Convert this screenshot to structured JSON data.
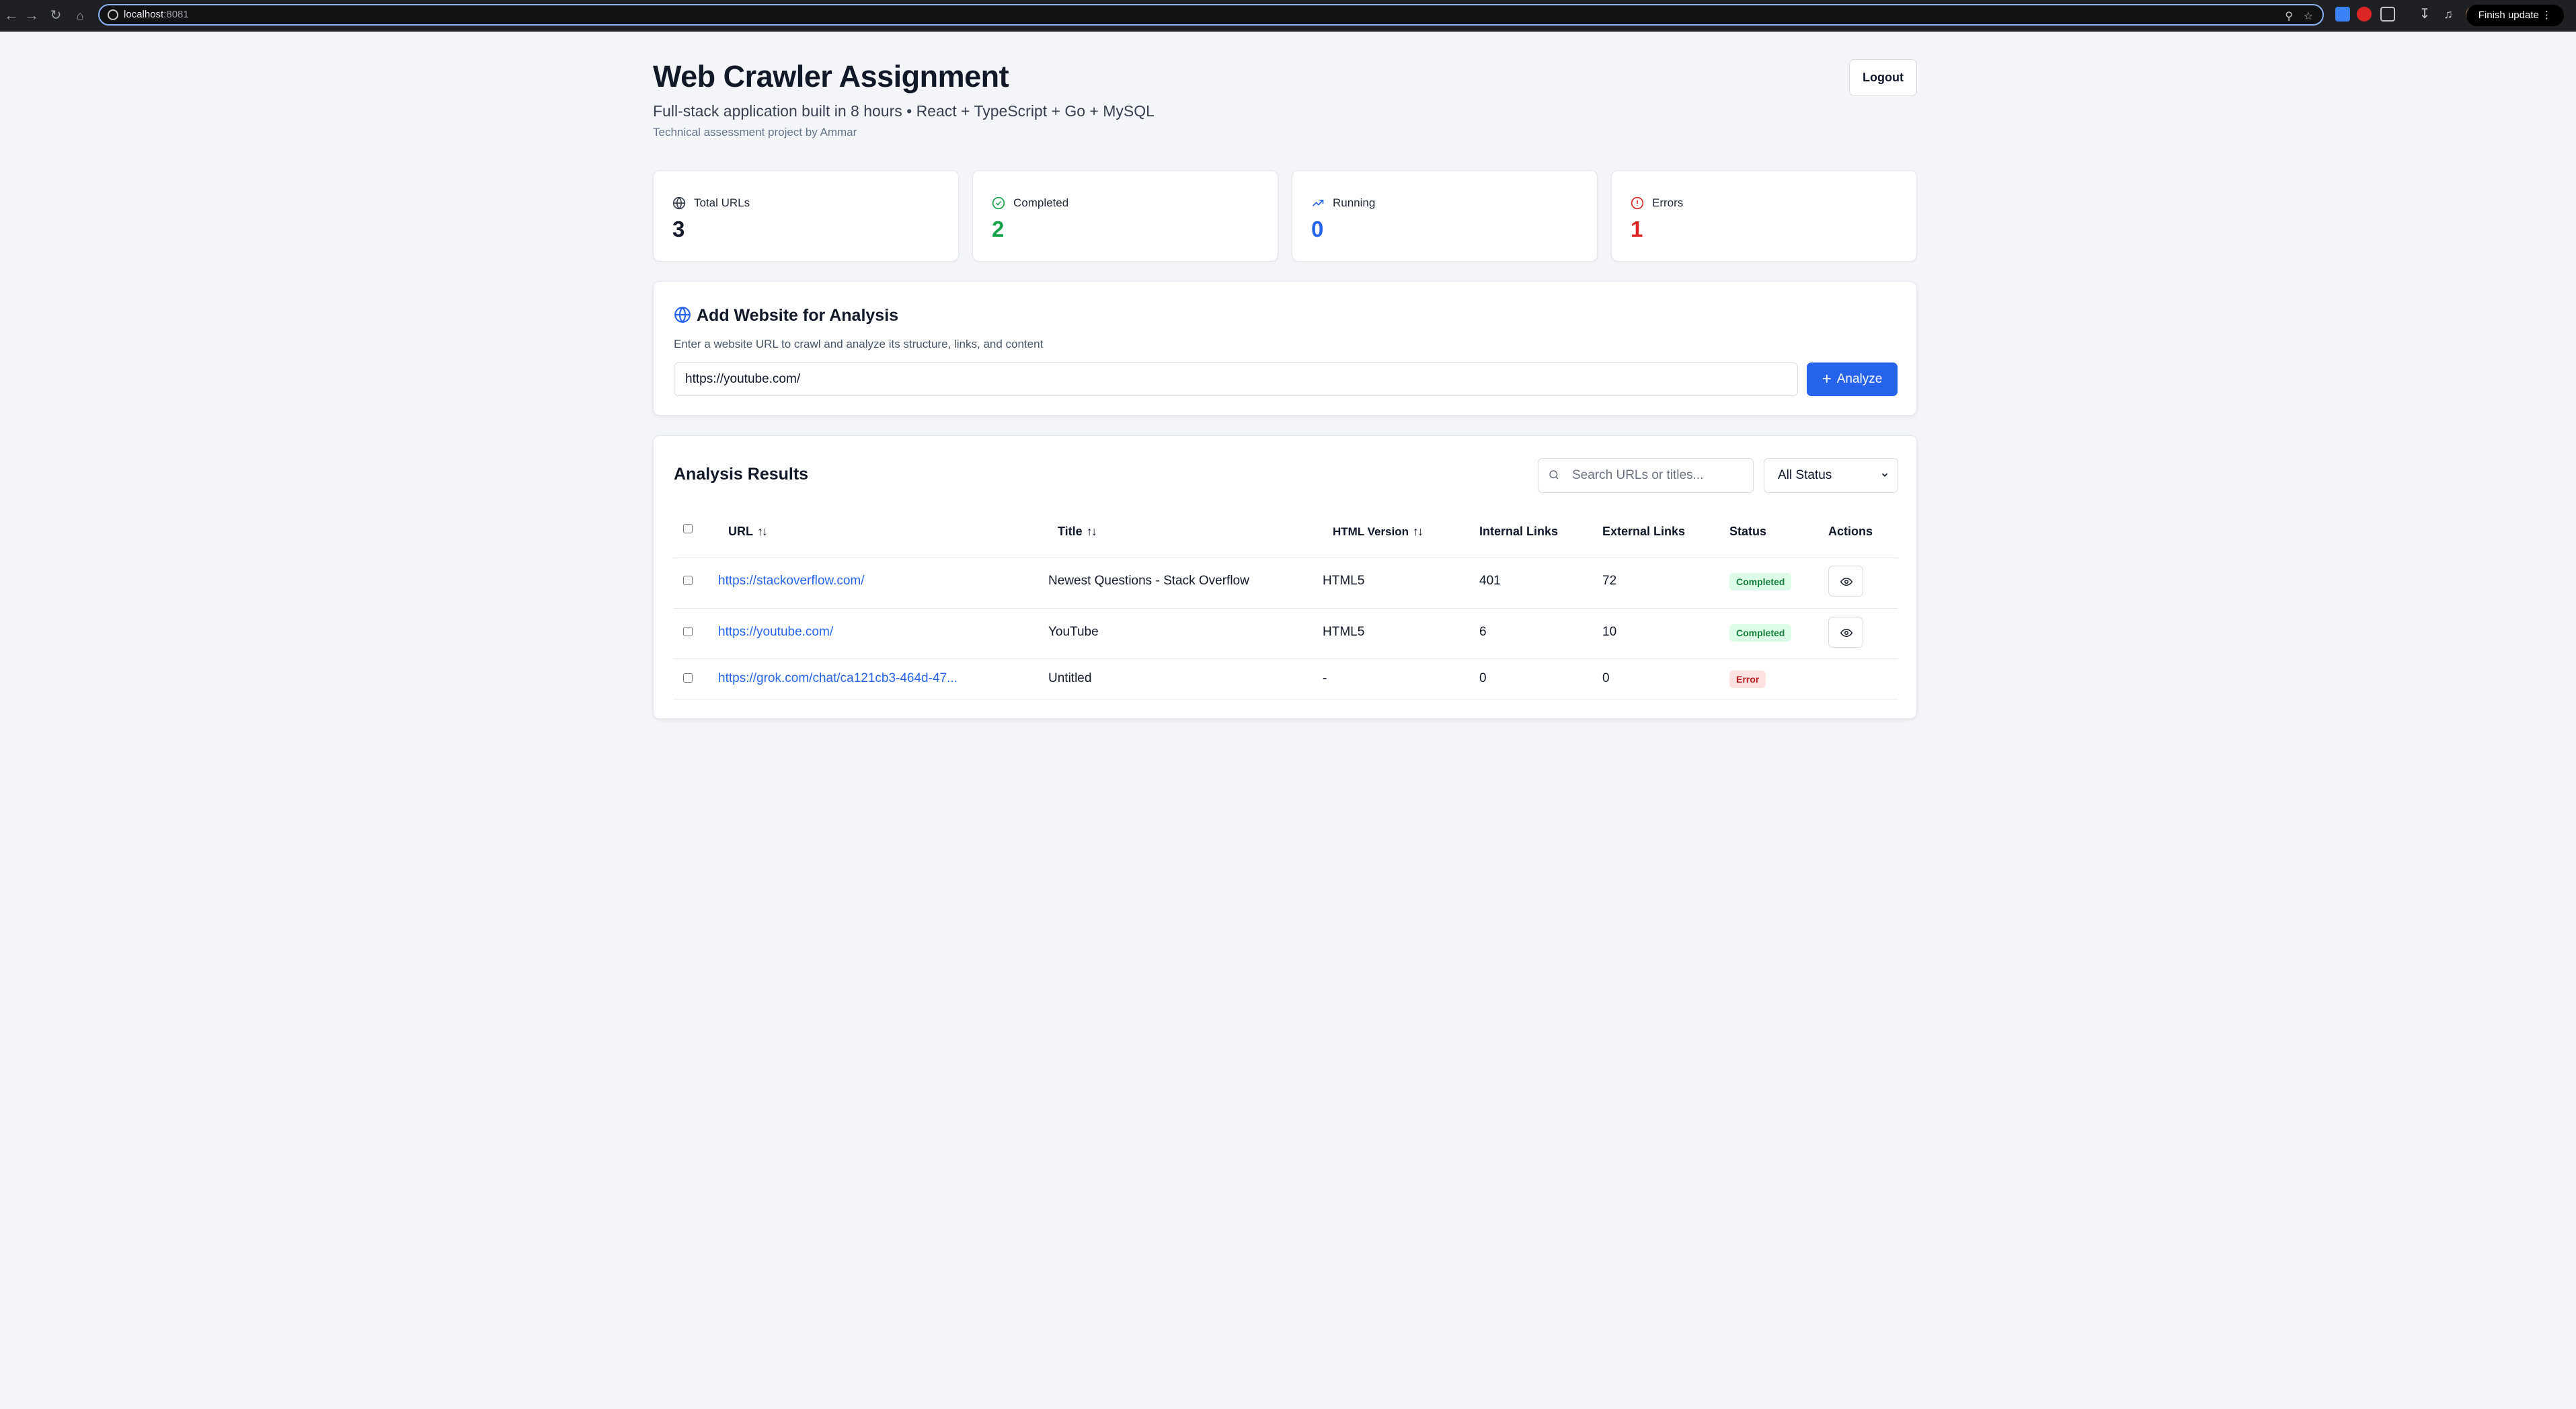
{
  "browser": {
    "host": "localhost",
    "port": ":8081",
    "finish_update": "Finish update"
  },
  "header": {
    "title": "Web Crawler Assignment",
    "subtitle": "Full-stack application built in 8 hours • React + TypeScript + Go + MySQL",
    "byline": "Technical assessment project by Ammar",
    "logout_label": "Logout"
  },
  "stats": [
    {
      "label": "Total URLs",
      "value": "3",
      "icon": "globe-icon",
      "color": "#111827"
    },
    {
      "label": "Completed",
      "value": "2",
      "icon": "check-circle-icon",
      "color": "#16a34a"
    },
    {
      "label": "Running",
      "value": "0",
      "icon": "trending-up-icon",
      "color": "#2563eb"
    },
    {
      "label": "Errors",
      "value": "1",
      "icon": "alert-circle-icon",
      "color": "#dc2626"
    }
  ],
  "add_panel": {
    "title": "Add Website for Analysis",
    "description": "Enter a website URL to crawl and analyze its structure, links, and content",
    "url_value": "https://youtube.com/",
    "analyze_label": "Analyze"
  },
  "results": {
    "title": "Analysis Results",
    "search_placeholder": "Search URLs or titles...",
    "status_filter": "All Status",
    "columns": {
      "url": "URL",
      "title": "Title",
      "html_version": "HTML Version",
      "internal_links": "Internal Links",
      "external_links": "External Links",
      "status": "Status",
      "actions": "Actions"
    },
    "rows": [
      {
        "url": "https://stackoverflow.com/",
        "title": "Newest Questions - Stack Overflow",
        "html_version": "HTML5",
        "internal": "401",
        "external": "72",
        "status": "Completed"
      },
      {
        "url": "https://youtube.com/",
        "title": "YouTube",
        "html_version": "HTML5",
        "internal": "6",
        "external": "10",
        "status": "Completed"
      },
      {
        "url": "https://grok.com/chat/ca121cb3-464d-47...",
        "title": "Untitled",
        "html_version": "-",
        "internal": "0",
        "external": "0",
        "status": "Error"
      }
    ]
  },
  "colors": {
    "accent": "#2563eb",
    "completed_badge": "#dcfce7",
    "error_badge": "#fee2e2"
  }
}
